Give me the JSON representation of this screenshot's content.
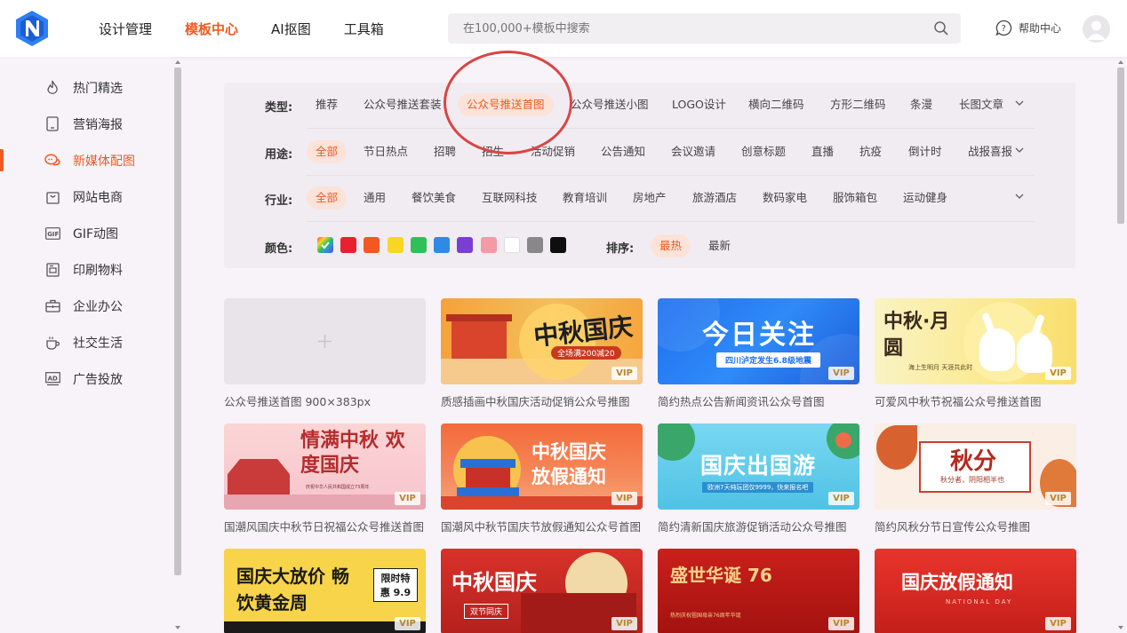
{
  "header": {
    "nav": [
      "设计管理",
      "模板中心",
      "AI抠图",
      "工具箱"
    ],
    "active_nav": "模板中心",
    "search_placeholder": "在100,000+模板中搜索",
    "help_label": "帮助中心"
  },
  "sidebar": {
    "items": [
      {
        "label": "热门精选",
        "icon": "flame-icon"
      },
      {
        "label": "营销海报",
        "icon": "phone-icon"
      },
      {
        "label": "新媒体配图",
        "icon": "chat-bubbles-icon"
      },
      {
        "label": "网站电商",
        "icon": "shopping-bag-icon"
      },
      {
        "label": "GIF动图",
        "icon": "gif-icon"
      },
      {
        "label": "印刷物料",
        "icon": "printer-icon"
      },
      {
        "label": "企业办公",
        "icon": "briefcase-icon"
      },
      {
        "label": "社交生活",
        "icon": "coffee-cup-icon"
      },
      {
        "label": "广告投放",
        "icon": "ad-icon"
      }
    ],
    "active_index": 2
  },
  "filters": {
    "type": {
      "label": "类型:",
      "options": [
        "推荐",
        "公众号推送套装",
        "公众号推送首图",
        "公众号推送小图",
        "LOGO设计",
        "横向二维码",
        "方形二维码",
        "条漫",
        "长图文章"
      ],
      "selected": "公众号推送首图"
    },
    "usage": {
      "label": "用途:",
      "options": [
        "全部",
        "节日热点",
        "招聘",
        "招生",
        "活动促销",
        "公告通知",
        "会议邀请",
        "创意标题",
        "直播",
        "抗疫",
        "倒计时",
        "战报喜报"
      ],
      "selected": "全部"
    },
    "industry": {
      "label": "行业:",
      "options": [
        "全部",
        "通用",
        "餐饮美食",
        "互联网科技",
        "教育培训",
        "房地产",
        "旅游酒店",
        "数码家电",
        "服饰箱包",
        "运动健身"
      ],
      "selected": "全部"
    },
    "color": {
      "label": "颜色:",
      "swatches": [
        "#f24b4b",
        "#e8212e",
        "#f05a22",
        "#f8d622",
        "#2fc05a",
        "#2f8ae6",
        "#7a3fd1",
        "#f39aa5",
        "#ffffff",
        "#8a8789",
        "#0e0e0e"
      ]
    },
    "sort": {
      "label": "排序:",
      "options": [
        "最热",
        "最新"
      ],
      "selected": "最热"
    }
  },
  "templates": [
    {
      "title": "公众号推送首图 900×383px",
      "vip": false,
      "blank": true
    },
    {
      "title": "质感插画中秋国庆活动促销公众号推图",
      "vip": true,
      "big": "中秋国庆",
      "sub": "全场满200减20"
    },
    {
      "title": "简约热点公告新闻资讯公众号首图",
      "vip": true,
      "big": "今日关注",
      "sub": "四川泸定发生6.8级地震"
    },
    {
      "title": "可爱风中秋节祝福公众号推送首图",
      "vip": true,
      "big": "中秋·月圆",
      "sub": "海上生明月 天涯共此时"
    },
    {
      "title": "国潮风国庆中秋节日祝福公众号推送首图",
      "vip": true,
      "big": "情满中秋 欢度国庆",
      "sub": "庆祝中华人民共和国成立73周年"
    },
    {
      "title": "国潮风中秋节国庆节放假通知公众号首图",
      "vip": true,
      "big": "中秋国庆 放假通知",
      "sub": ""
    },
    {
      "title": "简约清新国庆旅游促销活动公众号推图",
      "vip": true,
      "big": "国庆出国游",
      "sub": "欧洲7天纯玩团仅9999，快来报名吧"
    },
    {
      "title": "简约风秋分节日宣传公众号推图",
      "vip": true,
      "big": "秋分",
      "sub": "秋分者，阴阳相半也"
    },
    {
      "title": "",
      "vip": true,
      "big": "国庆大放价 畅饮黄金周",
      "sub": "限时特惠 9.9"
    },
    {
      "title": "",
      "vip": true,
      "big": "中秋国庆",
      "sub": "双节同庆"
    },
    {
      "title": "",
      "vip": true,
      "big": "盛世华诞 76",
      "sub": "热烈庆祝祖国母亲76周年华诞"
    },
    {
      "title": "",
      "vip": true,
      "big": "国庆放假通知",
      "sub": "NATIONAL DAY"
    }
  ],
  "vip_label": "VIP"
}
